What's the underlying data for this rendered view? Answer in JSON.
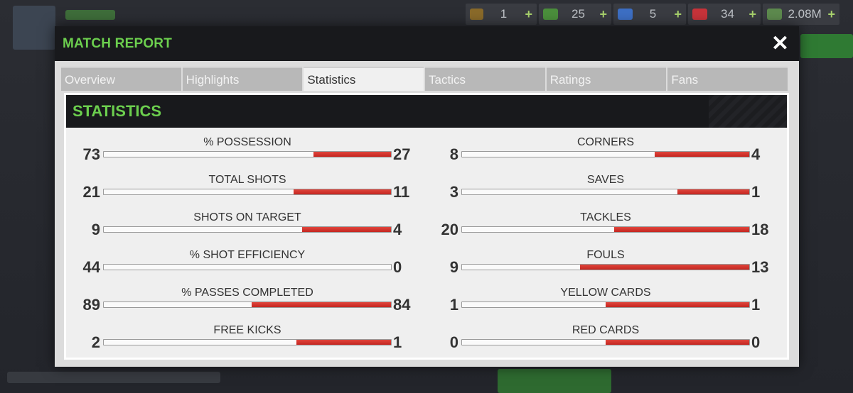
{
  "topbar": {
    "resources": [
      {
        "icon": "token-coin-icon",
        "value": "1",
        "color": "#8a6a2a"
      },
      {
        "icon": "cash-icon",
        "value": "25",
        "color": "#4b8f3c"
      },
      {
        "icon": "energy-icon",
        "value": "5",
        "color": "#3d6fc4"
      },
      {
        "icon": "medical-icon",
        "value": "34",
        "color": "#c8333a"
      },
      {
        "icon": "money-icon",
        "value": "2.08M",
        "color": "#5d8a4e"
      }
    ],
    "plus": "+"
  },
  "modal": {
    "title": "MATCH REPORT",
    "close": "✕"
  },
  "tabs": [
    "Overview",
    "Highlights",
    "Statistics",
    "Tactics",
    "Ratings",
    "Fans"
  ],
  "active_tab": "Statistics",
  "panel": {
    "title": "STATISTICS"
  },
  "stats_left": [
    {
      "label": "% POSSESSION",
      "home": "73",
      "away": "27",
      "away_share": 0.27
    },
    {
      "label": "TOTAL SHOTS",
      "home": "21",
      "away": "11",
      "away_share": 0.34
    },
    {
      "label": "SHOTS ON TARGET",
      "home": "9",
      "away": "4",
      "away_share": 0.31
    },
    {
      "label": "% SHOT EFFICIENCY",
      "home": "44",
      "away": "0",
      "away_share": 0.0
    },
    {
      "label": "% PASSES COMPLETED",
      "home": "89",
      "away": "84",
      "away_share": 0.485
    },
    {
      "label": "FREE KICKS",
      "home": "2",
      "away": "1",
      "away_share": 0.33
    }
  ],
  "stats_right": [
    {
      "label": "CORNERS",
      "home": "8",
      "away": "4",
      "away_share": 0.33
    },
    {
      "label": "SAVES",
      "home": "3",
      "away": "1",
      "away_share": 0.25
    },
    {
      "label": "TACKLES",
      "home": "20",
      "away": "18",
      "away_share": 0.47
    },
    {
      "label": "FOULS",
      "home": "9",
      "away": "13",
      "away_share": 0.59
    },
    {
      "label": "YELLOW CARDS",
      "home": "1",
      "away": "1",
      "away_share": 0.5
    },
    {
      "label": "RED CARDS",
      "home": "0",
      "away": "0",
      "away_share": 0.5
    }
  ]
}
